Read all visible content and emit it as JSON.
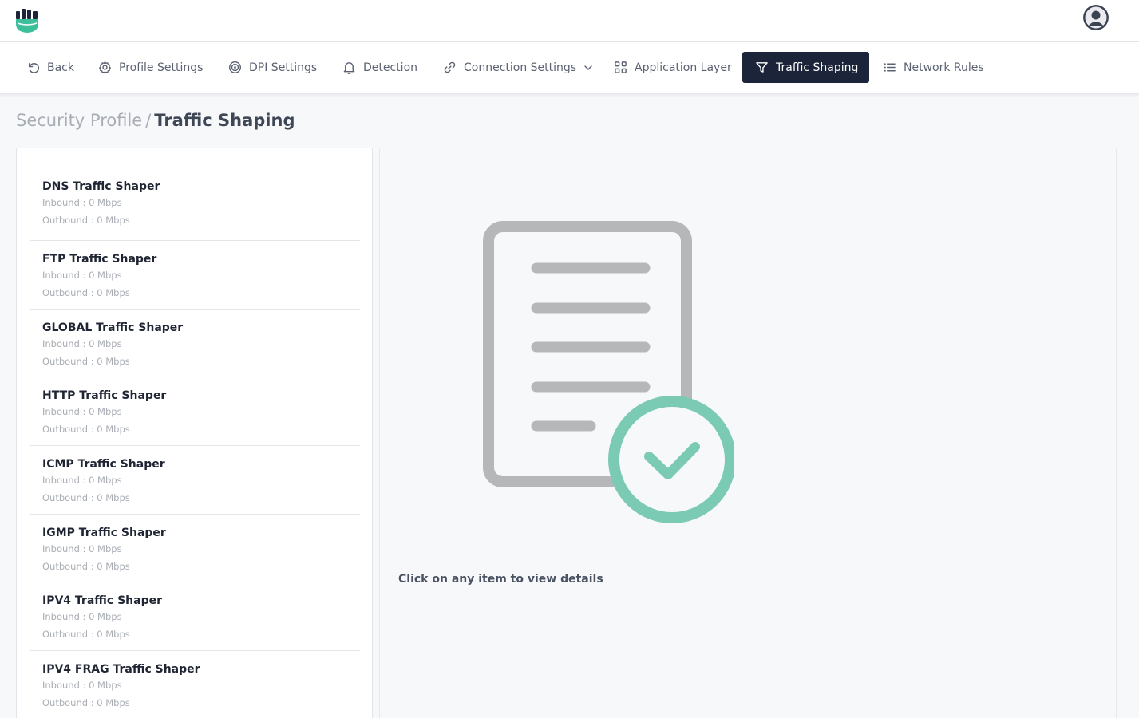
{
  "nav": {
    "back": "Back",
    "profile_settings": "Profile Settings",
    "dpi_settings": "DPI Settings",
    "detection": "Detection",
    "connection_settings": "Connection Settings",
    "application_layer": "Application Layer",
    "traffic_shaping": "Traffic Shaping",
    "network_rules": "Network Rules"
  },
  "breadcrumb": {
    "parent": "Security Profile",
    "separator": "/",
    "current": "Traffic Shaping"
  },
  "shapers": [
    {
      "name": "DNS Traffic Shaper",
      "inbound": "Inbound : 0 Mbps",
      "outbound": "Outbound : 0 Mbps"
    },
    {
      "name": "FTP Traffic Shaper",
      "inbound": "Inbound : 0 Mbps",
      "outbound": "Outbound : 0 Mbps"
    },
    {
      "name": "GLOBAL Traffic Shaper",
      "inbound": "Inbound : 0 Mbps",
      "outbound": "Outbound : 0 Mbps"
    },
    {
      "name": "HTTP Traffic Shaper",
      "inbound": "Inbound : 0 Mbps",
      "outbound": "Outbound : 0 Mbps"
    },
    {
      "name": "ICMP Traffic Shaper",
      "inbound": "Inbound : 0 Mbps",
      "outbound": "Outbound : 0 Mbps"
    },
    {
      "name": "IGMP Traffic Shaper",
      "inbound": "Inbound : 0 Mbps",
      "outbound": "Outbound : 0 Mbps"
    },
    {
      "name": "IPV4 Traffic Shaper",
      "inbound": "Inbound : 0 Mbps",
      "outbound": "Outbound : 0 Mbps"
    },
    {
      "name": "IPV4 FRAG Traffic Shaper",
      "inbound": "Inbound : 0 Mbps",
      "outbound": "Outbound : 0 Mbps"
    }
  ],
  "detail": {
    "hint": "Click on any item to view details"
  },
  "icons": {
    "logo": "fist-shield-logo",
    "avatar": "user-avatar-icon",
    "illustration": "document-check-icon"
  },
  "colors": {
    "accent_teal": "#3dbf9c",
    "active_tab_bg": "#1b2438",
    "illustration_gray": "#b5b7b9",
    "illustration_check": "#7acab4"
  }
}
